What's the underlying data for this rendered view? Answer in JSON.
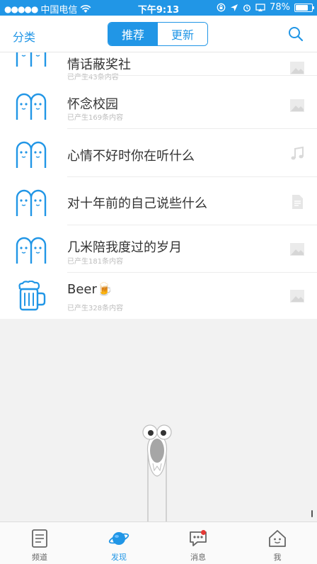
{
  "status_bar": {
    "signal_dots": "●●●●●",
    "carrier": "中国电信",
    "time": "下午9:13",
    "battery": "78%",
    "battery_level": 0.78
  },
  "nav": {
    "left_label": "分类",
    "segments": [
      {
        "label": "推荐",
        "active": true
      },
      {
        "label": "更新",
        "active": false
      }
    ]
  },
  "list": [
    {
      "title": "情话蔽奖社",
      "subtitle": "已产生43条内容",
      "type_icon": "image-icon"
    },
    {
      "title": "怀念校园",
      "subtitle": "已产生169条内容",
      "type_icon": "image-icon"
    },
    {
      "title": "心情不好时你在听什么",
      "subtitle": "",
      "type_icon": "music-icon"
    },
    {
      "title": "对十年前的自己说些什么",
      "subtitle": "",
      "type_icon": "document-icon"
    },
    {
      "title": "几米陪我度过的岁月",
      "subtitle": "已产生181条内容",
      "type_icon": "image-icon"
    },
    {
      "title": "Beer🍺",
      "subtitle": "已产生328条内容",
      "type_icon": "image-icon"
    }
  ],
  "tabs": [
    {
      "label": "频道",
      "icon": "channel-icon",
      "active": false
    },
    {
      "label": "发现",
      "icon": "discover-planet-icon",
      "active": true
    },
    {
      "label": "消息",
      "icon": "message-icon",
      "active": false,
      "badge": true
    },
    {
      "label": "我",
      "icon": "me-home-icon",
      "active": false
    }
  ],
  "colors": {
    "accent": "#2196e6",
    "badge": "#e53935"
  }
}
